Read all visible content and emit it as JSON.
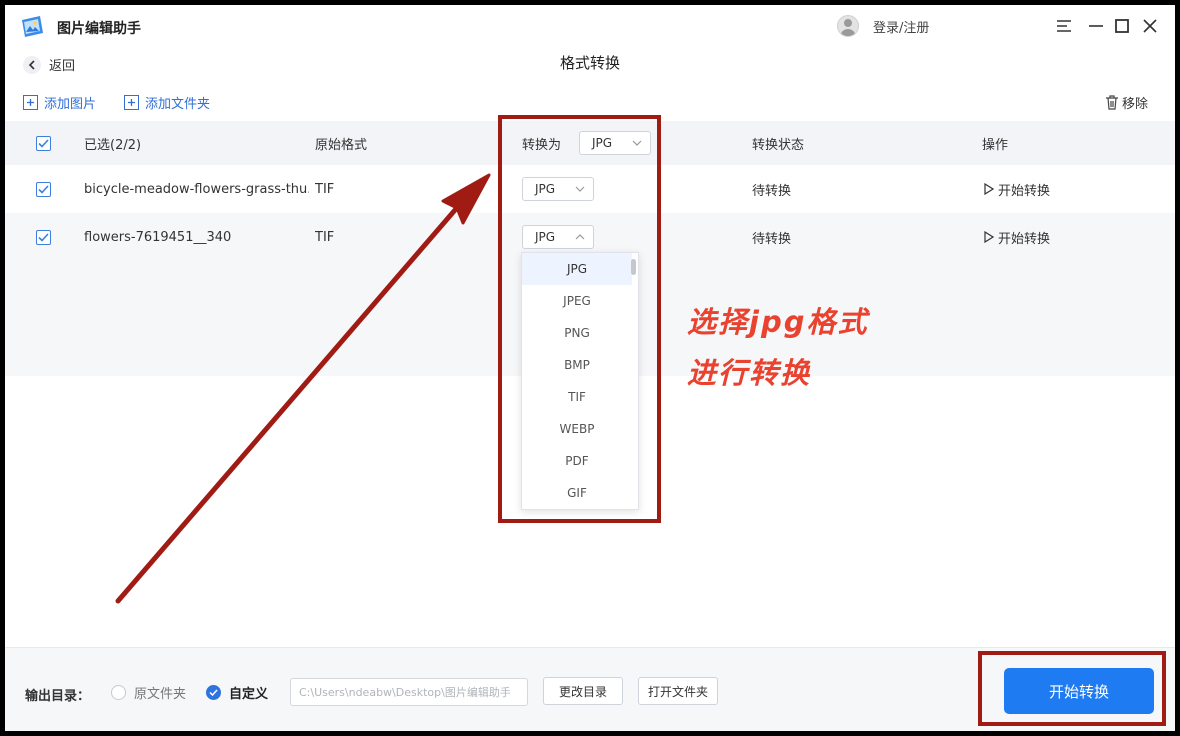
{
  "app": {
    "title": "图片编辑助手"
  },
  "user": {
    "login_label": "登录/注册"
  },
  "nav": {
    "back_label": "返回",
    "page_title": "格式转换"
  },
  "toolbar": {
    "add_image": "添加图片",
    "add_folder": "添加文件夹",
    "remove": "移除"
  },
  "table": {
    "headers": {
      "selected": "已选(2/2)",
      "original_format": "原始格式",
      "convert_to": "转换为",
      "status": "转换状态",
      "action": "操作"
    },
    "global_format": "JPG",
    "rows": [
      {
        "name": "bicycle-meadow-flowers-grass-thu...",
        "format": "TIF",
        "target": "JPG",
        "status": "待转换",
        "action": "开始转换"
      },
      {
        "name": "flowers-7619451__340",
        "format": "TIF",
        "target": "JPG",
        "status": "待转换",
        "action": "开始转换"
      }
    ]
  },
  "dropdown": {
    "options": [
      "JPG",
      "JPEG",
      "PNG",
      "BMP",
      "TIF",
      "WEBP",
      "PDF",
      "GIF"
    ],
    "selected": "JPG"
  },
  "footer": {
    "output_label": "输出目录：",
    "radio_original": "原文件夹",
    "radio_custom": "自定义",
    "path": "C:\\Users\\ndeabw\\Desktop\\图片编辑助手",
    "change_dir": "更改目录",
    "open_folder": "打开文件夹",
    "start_button": "开始转换"
  },
  "annotation": {
    "line1": "选择jpg格式",
    "line2": "进行转换"
  },
  "colors": {
    "accent": "#1f7bf2",
    "annotation_box": "#a01b14",
    "annotation_text": "#e9422f"
  }
}
